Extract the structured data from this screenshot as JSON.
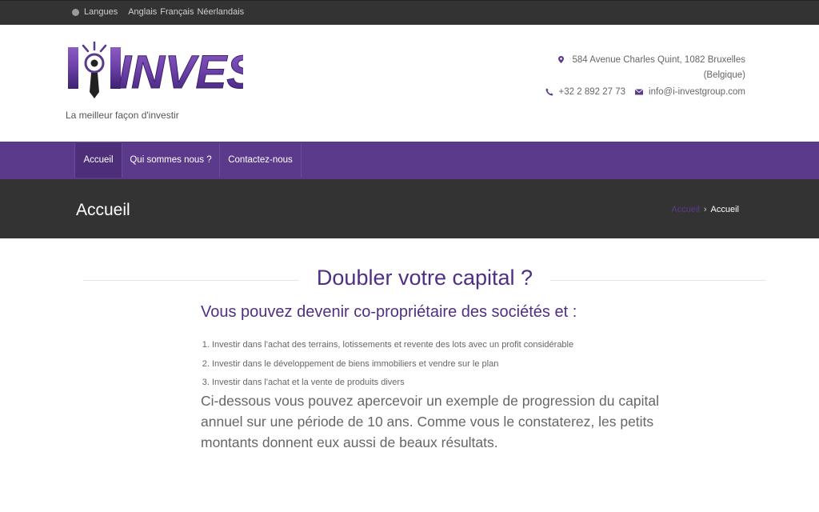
{
  "topbar": {
    "language_label": "Langues",
    "languages": [
      "Anglais",
      "Français",
      "Néerlandais"
    ]
  },
  "header": {
    "logo_text": "INVEST",
    "logo_letter": "I",
    "tagline": "La meilleur façon d'investir",
    "address_line1": "584 Avenue Charles Quint, 1082 Bruxelles",
    "address_line2": "(Belgique)",
    "phone": "+32 2 892 27 73",
    "email": "info@i-investgroup.com"
  },
  "nav": {
    "items": [
      "Accueil",
      "Qui sommes nous ?",
      "Contactez-nous"
    ],
    "active": "Accueil"
  },
  "page": {
    "title": "Accueil",
    "breadcrumb_home": "Accueil",
    "breadcrumb_current": "Accueil"
  },
  "content": {
    "heading": "Doubler votre capital ?",
    "subheading": "Vous pouvez devenir co-propriétaire des sociétés et :",
    "list": [
      "Investir dans l'achat des terrains, lotissements et revente des lots avec un profit considérable",
      "Investir dans le développement de biens immobiliers et vendre sur le plan",
      "Investir dans l'achat et la vente de produits divers"
    ],
    "paragraph": "Ci-dessous vous pouvez apercevoir un exemple de progression du capital annuel sur une période de 10 ans. Comme vous le constaterez, les petits montants donnent eux aussi de beaux résultats."
  },
  "colors": {
    "brand_purple": "#5b3a8c",
    "dark_bar": "#333333",
    "heading_purple": "#4f2f86"
  }
}
